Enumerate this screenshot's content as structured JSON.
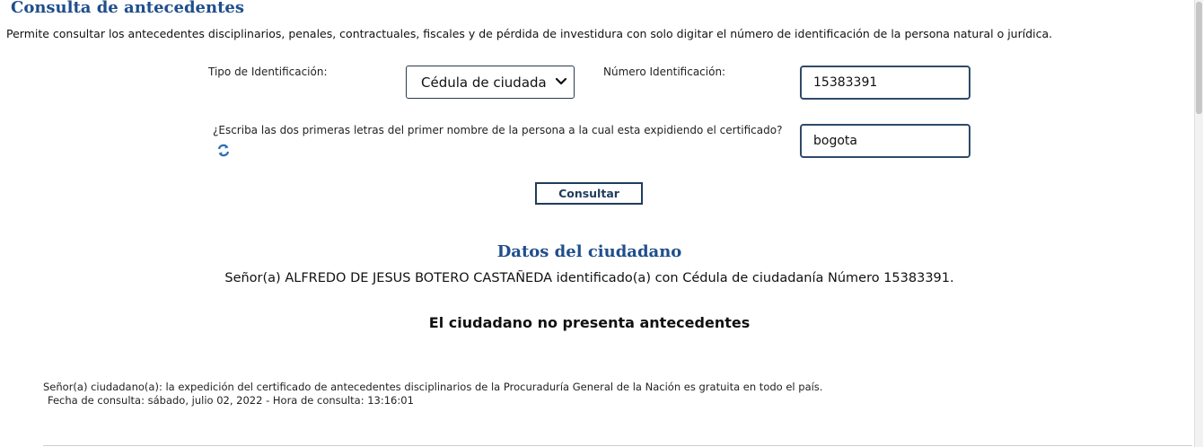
{
  "page": {
    "title": "Consulta de antecedentes",
    "intro": "Permite consultar los antecedentes disciplinarios, penales, contractuales, fiscales y de pérdida de investidura con solo digitar el número de identificación de la persona natural o jurídica."
  },
  "form": {
    "id_type_label": "Tipo de Identificación:",
    "id_type_value": "Cédula de ciudadan",
    "id_number_label": "Número Identificación:",
    "id_number_value": "15383391",
    "question_label": "¿Escriba las dos primeras letras del primer nombre de la persona a la cual esta expidiendo el certificado?",
    "answer_value": "bogota",
    "submit_label": "Consultar"
  },
  "results": {
    "section_title": "Datos del ciudadano",
    "person_line": "Señor(a)  ALFREDO DE JESUS BOTERO CASTAÑEDA identificado(a) con Cédula de ciudadanía Número 15383391.",
    "status": "El ciudadano no presenta antecedentes"
  },
  "footer": {
    "note": "Señor(a) ciudadano(a): la expedición del certificado de antecedentes disciplinarios de la Procuraduría General de la Nación es gratuita en todo el país.",
    "query_date": "Fecha de consulta: sábado, julio 02, 2022 - Hora de consulta: 13:16:01"
  },
  "icons": {
    "refresh": "refresh-icon",
    "dropdown": "chevron-down-icon"
  },
  "colors": {
    "title_blue": "#1f4e8c",
    "border_dark": "#2e4a6a"
  }
}
